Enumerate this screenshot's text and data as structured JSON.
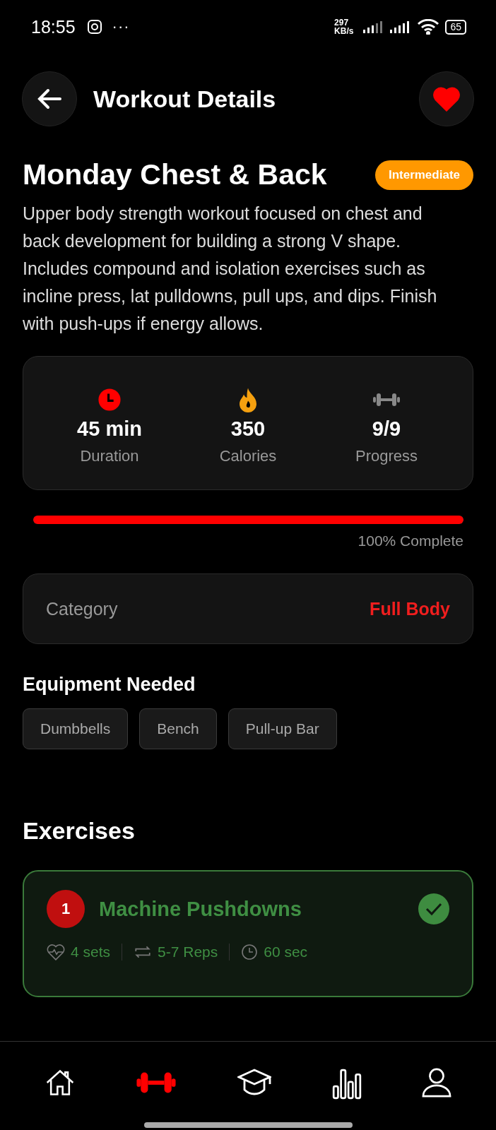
{
  "status_bar": {
    "time": "18:55",
    "more": "···",
    "speed_value": "297",
    "speed_unit": "KB/s",
    "battery": "65"
  },
  "header": {
    "title": "Workout Details",
    "favorite": true
  },
  "workout": {
    "title": "Monday Chest & Back",
    "level_badge": "Intermediate",
    "description": "Upper body strength workout focused on chest and back development for building a strong V shape. Includes compound and isolation exercises such as incline press, lat pulldowns, pull ups, and dips. Finish with push-ups if energy allows."
  },
  "stats": [
    {
      "kind": "clock",
      "value": "45 min",
      "label": "Duration"
    },
    {
      "kind": "flame",
      "value": "350",
      "label": "Calories"
    },
    {
      "kind": "dumbbell",
      "value": "9/9",
      "label": "Progress"
    }
  ],
  "progress": {
    "level": 1,
    "label": "100% Complete"
  },
  "category": {
    "label": "Category",
    "value": "Full Body"
  },
  "equipment": {
    "title": "Equipment Needed",
    "items": [
      "Dumbbells",
      "Bench",
      "Pull-up Bar"
    ]
  },
  "exercises": {
    "title": "Exercises",
    "items": [
      {
        "number": "1",
        "name": "Machine Pushdowns",
        "completed": true,
        "sets": "4 sets",
        "reps": "5-7 Reps",
        "rest": "60 sec"
      }
    ]
  },
  "nav": [
    {
      "kind": "home",
      "selected": false
    },
    {
      "kind": "dumbbell",
      "selected": true
    },
    {
      "kind": "graduation",
      "selected": false
    },
    {
      "kind": "stats",
      "selected": false
    },
    {
      "kind": "profile",
      "selected": false
    }
  ]
}
